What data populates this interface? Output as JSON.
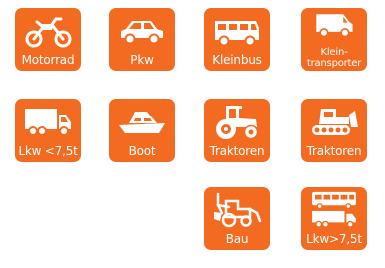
{
  "colors": {
    "tile": "#f26b21",
    "icon": "#ffffff"
  },
  "tiles": [
    {
      "label": "Motorrad",
      "icon": "motorcycle-icon"
    },
    {
      "label": "Pkw",
      "icon": "car-icon"
    },
    {
      "label": "Kleinbus",
      "icon": "minibus-icon"
    },
    {
      "label_line1": "Klein-",
      "label_line2": "transporter",
      "icon": "van-icon"
    },
    {
      "label": "Lkw <7,5t",
      "icon": "truck-icon"
    },
    {
      "label": "Boot",
      "icon": "boat-icon"
    },
    {
      "label": "Traktoren",
      "icon": "tractor-icon"
    },
    {
      "label": "Traktoren",
      "icon": "crawler-tractor-icon"
    },
    {
      "label": "Bau",
      "icon": "backhoe-icon"
    },
    {
      "label": "Lkw>7,5t",
      "icon": "bus-and-truck-icon"
    }
  ]
}
